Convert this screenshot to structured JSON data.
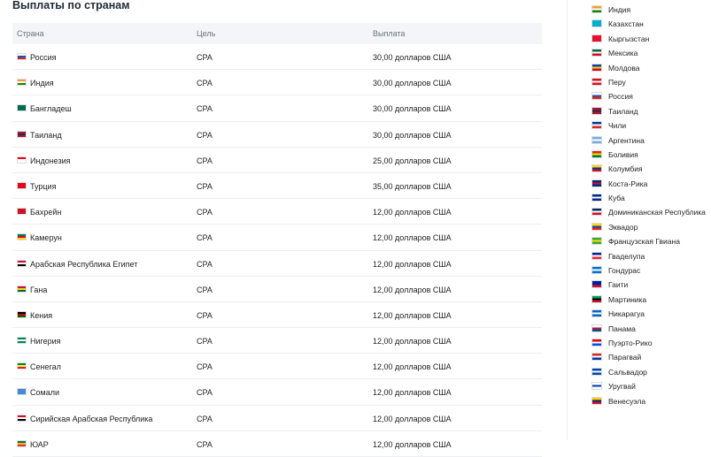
{
  "title": "Выплаты по странам",
  "table": {
    "headers": [
      "Страна",
      "Цель",
      "Выплата"
    ],
    "rows": [
      {
        "country": "Россия",
        "goal": "CPA",
        "payout": "30,00 долларов США",
        "flag_colors": [
          "#ffffff",
          "#1f4fb8",
          "#d52b1e"
        ]
      },
      {
        "country": "Индия",
        "goal": "CPA",
        "payout": "30,00 долларов США",
        "flag_colors": [
          "#ff9933",
          "#ffffff",
          "#138808"
        ]
      },
      {
        "country": "Бангладеш",
        "goal": "CPA",
        "payout": "30,00 долларов США",
        "flag_colors": [
          "#006a4e",
          "#006a4e",
          "#006a4e"
        ]
      },
      {
        "country": "Таиланд",
        "goal": "CPA",
        "payout": "30,00 долларов США",
        "flag_colors": [
          "#a51931",
          "#2d2a4a",
          "#a51931"
        ]
      },
      {
        "country": "Индонезия",
        "goal": "CPA",
        "payout": "25,00 долларов США",
        "flag_colors": [
          "#e70011",
          "#ffffff",
          "#ffffff"
        ]
      },
      {
        "country": "Турция",
        "goal": "CPA",
        "payout": "35,00 долларов США",
        "flag_colors": [
          "#e30a17",
          "#e30a17",
          "#e30a17"
        ]
      },
      {
        "country": "Бахрейн",
        "goal": "CPA",
        "payout": "12,00 долларов США",
        "flag_colors": [
          "#ce1126",
          "#ce1126",
          "#ce1126"
        ]
      },
      {
        "country": "Камерун",
        "goal": "CPA",
        "payout": "12,00 долларов США",
        "flag_colors": [
          "#007a5e",
          "#ce1126",
          "#fcd116"
        ]
      },
      {
        "country": "Арабская Республика Египет",
        "goal": "CPA",
        "payout": "12,00 долларов США",
        "flag_colors": [
          "#ce1126",
          "#ffffff",
          "#000000"
        ]
      },
      {
        "country": "Гана",
        "goal": "CPA",
        "payout": "12,00 долларов США",
        "flag_colors": [
          "#ce1126",
          "#fcd116",
          "#006b3f"
        ]
      },
      {
        "country": "Кения",
        "goal": "CPA",
        "payout": "12,00 долларов США",
        "flag_colors": [
          "#000000",
          "#bb0000",
          "#006600"
        ]
      },
      {
        "country": "Нигерия",
        "goal": "CPA",
        "payout": "12,00 долларов США",
        "flag_colors": [
          "#008751",
          "#ffffff",
          "#008751"
        ]
      },
      {
        "country": "Сенегал",
        "goal": "CPA",
        "payout": "12,00 долларов США",
        "flag_colors": [
          "#00853f",
          "#fdef42",
          "#e31b23"
        ]
      },
      {
        "country": "Сомали",
        "goal": "CPA",
        "payout": "12,00 долларов США",
        "flag_colors": [
          "#4189dd",
          "#4189dd",
          "#4189dd"
        ]
      },
      {
        "country": "Сирийская Арабская Республика",
        "goal": "CPA",
        "payout": "12,00 долларов США",
        "flag_colors": [
          "#ce1126",
          "#ffffff",
          "#000000"
        ]
      },
      {
        "country": "ЮАР",
        "goal": "CPA",
        "payout": "12,00 долларов США",
        "flag_colors": [
          "#007749",
          "#ffb612",
          "#de3831"
        ]
      }
    ]
  },
  "sidebar": {
    "countries": [
      {
        "name": "Индия",
        "flag_colors": [
          "#ff9933",
          "#ffffff",
          "#138808"
        ]
      },
      {
        "name": "Казахстан",
        "flag_colors": [
          "#00afca",
          "#00afca",
          "#00afca"
        ]
      },
      {
        "name": "Кыргызстан",
        "flag_colors": [
          "#e8112d",
          "#e8112d",
          "#e8112d"
        ]
      },
      {
        "name": "Мексика",
        "flag_colors": [
          "#006847",
          "#ffffff",
          "#ce1126"
        ]
      },
      {
        "name": "Молдова",
        "flag_colors": [
          "#0046ae",
          "#ffd200",
          "#cc092f"
        ]
      },
      {
        "name": "Перу",
        "flag_colors": [
          "#d91023",
          "#ffffff",
          "#d91023"
        ]
      },
      {
        "name": "Россия",
        "flag_colors": [
          "#ffffff",
          "#1f4fb8",
          "#d52b1e"
        ]
      },
      {
        "name": "Таиланд",
        "flag_colors": [
          "#a51931",
          "#2d2a4a",
          "#a51931"
        ]
      },
      {
        "name": "Чили",
        "flag_colors": [
          "#0039a6",
          "#ffffff",
          "#d52b1e"
        ]
      },
      {
        "name": "Аргентина",
        "flag_colors": [
          "#74acdf",
          "#ffffff",
          "#74acdf"
        ]
      },
      {
        "name": "Боливия",
        "flag_colors": [
          "#d52b1e",
          "#f9e300",
          "#007934"
        ]
      },
      {
        "name": "Колумбия",
        "flag_colors": [
          "#fcd116",
          "#003893",
          "#ce1126"
        ]
      },
      {
        "name": "Коста-Рика",
        "flag_colors": [
          "#002b7f",
          "#ce1126",
          "#002b7f"
        ]
      },
      {
        "name": "Куба",
        "flag_colors": [
          "#002a8f",
          "#ffffff",
          "#002a8f"
        ]
      },
      {
        "name": "Доминиканская Республика",
        "flag_colors": [
          "#002d62",
          "#ffffff",
          "#ce1126"
        ]
      },
      {
        "name": "Эквадор",
        "flag_colors": [
          "#ffdd00",
          "#034ea2",
          "#ed1c24"
        ]
      },
      {
        "name": "Французская Гвиана",
        "flag_colors": [
          "#3aa935",
          "#fcdd09",
          "#3aa935"
        ]
      },
      {
        "name": "Гваделупа",
        "flag_colors": [
          "#002395",
          "#ffffff",
          "#ed2939"
        ]
      },
      {
        "name": "Гондурас",
        "flag_colors": [
          "#0073cf",
          "#ffffff",
          "#0073cf"
        ]
      },
      {
        "name": "Гаити",
        "flag_colors": [
          "#00209f",
          "#00209f",
          "#d21034"
        ]
      },
      {
        "name": "Мартиника",
        "flag_colors": [
          "#00a650",
          "#000000",
          "#d21034"
        ]
      },
      {
        "name": "Никарагуа",
        "flag_colors": [
          "#0067c6",
          "#ffffff",
          "#0067c6"
        ]
      },
      {
        "name": "Панама",
        "flag_colors": [
          "#ffffff",
          "#d21034",
          "#005293"
        ]
      },
      {
        "name": "Пуэрто-Рико",
        "flag_colors": [
          "#ed0000",
          "#ffffff",
          "#0050f0"
        ]
      },
      {
        "name": "Парагвай",
        "flag_colors": [
          "#d52b1e",
          "#ffffff",
          "#0038a8"
        ]
      },
      {
        "name": "Сальвадор",
        "flag_colors": [
          "#0047ab",
          "#ffffff",
          "#0047ab"
        ]
      },
      {
        "name": "Уругвай",
        "flag_colors": [
          "#ffffff",
          "#0038a8",
          "#ffffff"
        ]
      },
      {
        "name": "Венесуэла",
        "flag_colors": [
          "#ffcc00",
          "#00247d",
          "#cf142b"
        ]
      }
    ]
  }
}
